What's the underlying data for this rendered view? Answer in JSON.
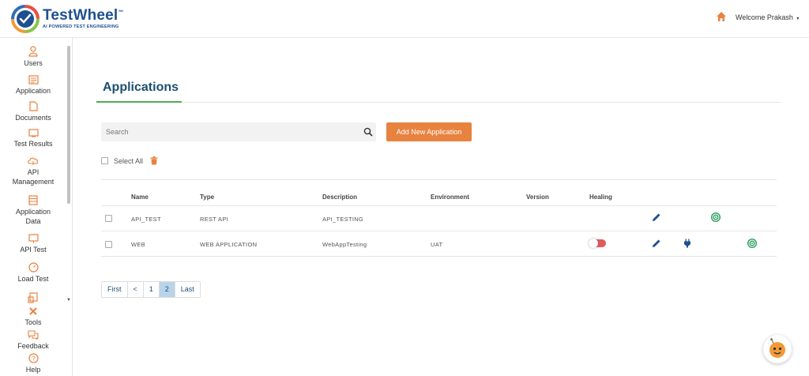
{
  "header": {
    "logo_title": "TestWheel",
    "logo_tm": "™",
    "logo_tagline": "AI POWERED TEST ENGINEERING",
    "welcome": "Welcome Prakash",
    "caret": "▾"
  },
  "sidebar": {
    "items": [
      {
        "label": "Users",
        "icon": "user-icon"
      },
      {
        "label": "Application",
        "icon": "application-icon"
      },
      {
        "label": "Documents",
        "icon": "document-icon"
      },
      {
        "label": "Test Results",
        "icon": "test-results-icon"
      },
      {
        "label": "API Management",
        "icon": "api-cloud-icon"
      },
      {
        "label": "Application Data",
        "icon": "application-data-icon"
      },
      {
        "label": "API Test",
        "icon": "api-test-icon"
      },
      {
        "label": "Load Test",
        "icon": "load-test-icon"
      },
      {
        "label": "Tools",
        "icon": "tools-icon"
      },
      {
        "label": "Feedback",
        "icon": "feedback-icon"
      },
      {
        "label": "Help",
        "icon": "help-icon"
      }
    ]
  },
  "main": {
    "title": "Applications",
    "search_placeholder": "Search",
    "add_button": "Add New Application",
    "select_all": "Select All",
    "columns": [
      "Name",
      "Type",
      "Description",
      "Environment",
      "Version",
      "Healing"
    ],
    "rows": [
      {
        "name": "API_TEST",
        "type": "REST API",
        "description": "API_TESTING",
        "environment": "",
        "version": "",
        "healing": null
      },
      {
        "name": "WEB",
        "type": "WEB APPLICATION",
        "description": "WebAppTesting",
        "environment": "UAT",
        "version": "",
        "healing": "off"
      }
    ],
    "pagination": [
      "First",
      "<",
      "1",
      "2",
      "Last"
    ],
    "current_page": "2"
  },
  "colors": {
    "brand_blue": "#1d4f91",
    "accent_orange": "#e8823f",
    "active_green": "#4caf50",
    "toggle_off": "#e05b5b",
    "page_active": "#b9d4ea"
  }
}
